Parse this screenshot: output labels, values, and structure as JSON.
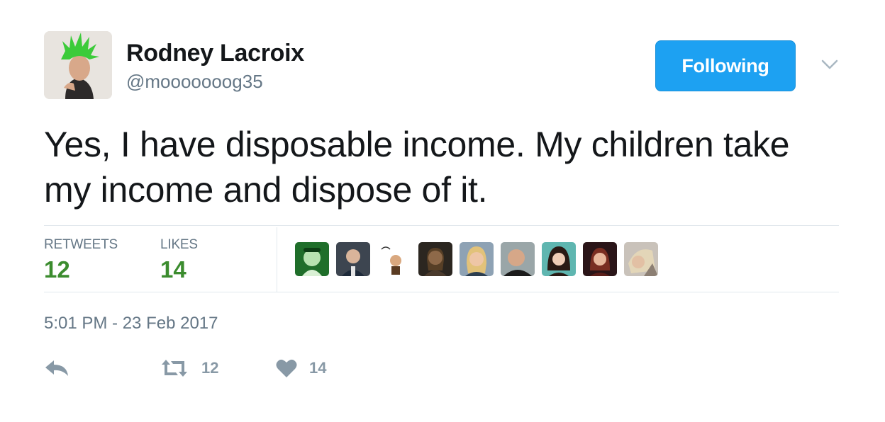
{
  "user": {
    "name": "Rodney Lacroix",
    "handle": "@mooooooog35"
  },
  "follow_button": {
    "label": "Following"
  },
  "tweet": {
    "text": "Yes, I have disposable income. My children take my income and dispose of it."
  },
  "stats": {
    "retweets_label": "RETWEETS",
    "retweets_count": "12",
    "likes_label": "LIKES",
    "likes_count": "14"
  },
  "timestamp": "5:01 PM - 23 Feb 2017",
  "actions": {
    "retweet_count": "12",
    "like_count": "14"
  },
  "colors": {
    "accent": "#1da1f2",
    "stat_green": "#3b8c2e",
    "muted": "#657786",
    "action_grey": "#8899a6"
  }
}
